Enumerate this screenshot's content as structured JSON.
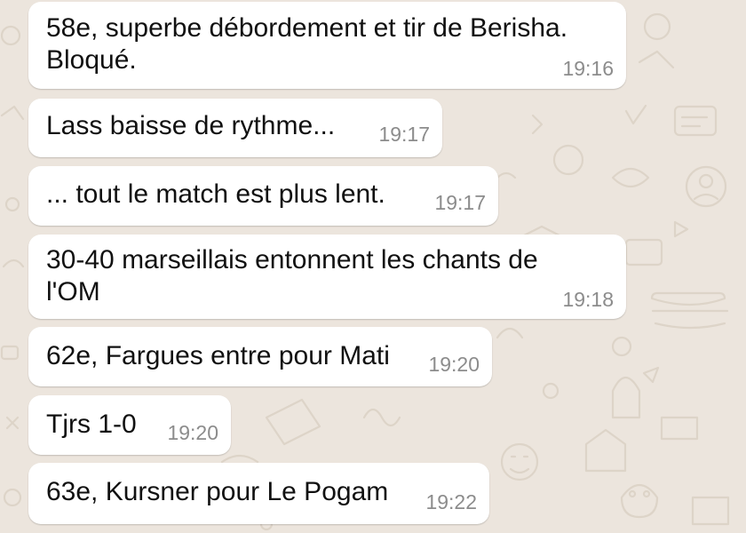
{
  "colors": {
    "wallpaper": "#ECE5DD",
    "bubble": "#FFFFFF",
    "message_text": "#111111",
    "timestamp": "#8C8C8C"
  },
  "messages": [
    {
      "text": "58e, superbe débordement et tir de Berisha.\nBloqué.",
      "time": "19:16"
    },
    {
      "text": "Lass baisse de rythme...",
      "time": "19:17"
    },
    {
      "text": "... tout le match est plus lent.",
      "time": "19:17"
    },
    {
      "text": "30-40 marseillais entonnent les chants de\nl'OM",
      "time": "19:18"
    },
    {
      "text": "62e, Fargues entre pour Mati",
      "time": "19:20"
    },
    {
      "text": "Tjrs 1-0",
      "time": "19:20"
    },
    {
      "text": "63e, Kursner pour Le Pogam",
      "time": "19:22"
    }
  ]
}
